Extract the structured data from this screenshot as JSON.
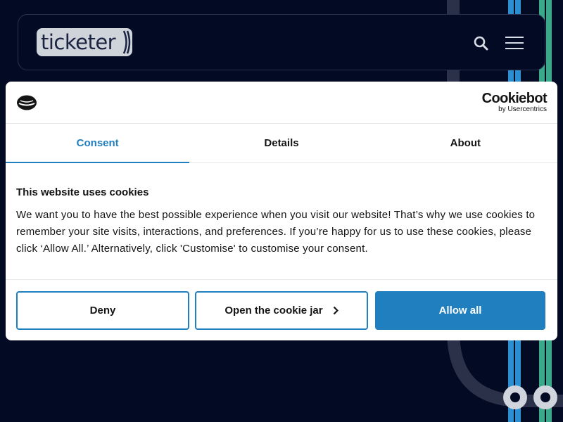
{
  "site": {
    "logo_text": "ticketer"
  },
  "header": {
    "search_icon": "search-icon",
    "menu_icon": "hamburger-menu-icon"
  },
  "cookie_dialog": {
    "brand_main": "Cookiebot",
    "brand_sub": "by Usercentrics",
    "tabs": [
      {
        "label": "Consent",
        "active": true
      },
      {
        "label": "Details",
        "active": false
      },
      {
        "label": "About",
        "active": false
      }
    ],
    "title": "This website uses cookies",
    "body": "We want you to have the best possible experience when you visit our website! That’s why we use cookies to remember your site visits, interactions, and preferences. If you’re happy for us to use these cookies, please click ‘Allow All.’ Alternatively, click 'Customise' to customise your consent.",
    "buttons": {
      "deny": "Deny",
      "open_jar": "Open the cookie jar",
      "allow_all": "Allow all"
    }
  },
  "colors": {
    "page_bg": "#030b24",
    "accent": "#1f7fbf",
    "line_blue": "#2a8fd0",
    "line_green": "#3aa98a"
  }
}
